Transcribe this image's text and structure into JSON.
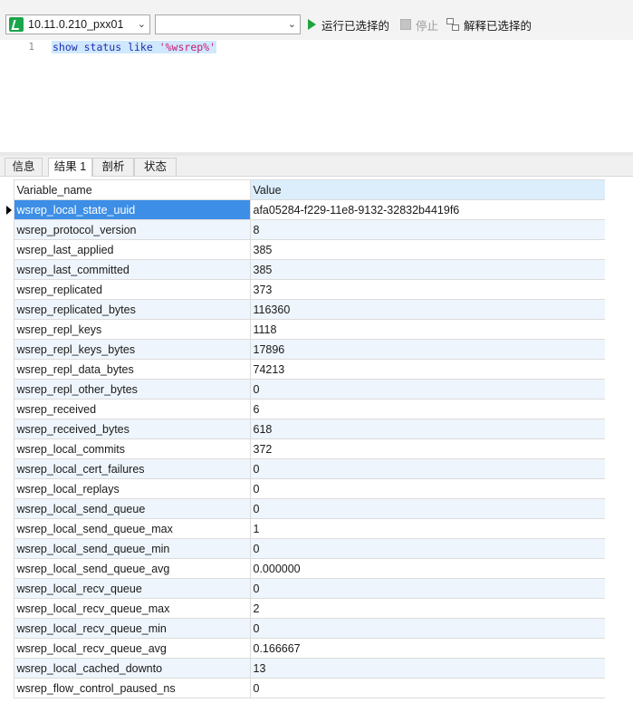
{
  "toolbar": {
    "connection": "10.11.0.210_pxx01",
    "database": "",
    "run_selected": "运行已选择的",
    "stop": "停止",
    "explain_selected": "解释已选择的"
  },
  "editor": {
    "line_number": "1",
    "kw1": "show status like ",
    "str": "'%wsrep%'"
  },
  "tabs": [
    "信息",
    "结果 1",
    "剖析",
    "状态"
  ],
  "grid": {
    "columns": [
      "Variable_name",
      "Value"
    ],
    "rows": [
      [
        "wsrep_local_state_uuid",
        "afa05284-f229-11e8-9132-32832b4419f6"
      ],
      [
        "wsrep_protocol_version",
        "8"
      ],
      [
        "wsrep_last_applied",
        "385"
      ],
      [
        "wsrep_last_committed",
        "385"
      ],
      [
        "wsrep_replicated",
        "373"
      ],
      [
        "wsrep_replicated_bytes",
        "116360"
      ],
      [
        "wsrep_repl_keys",
        "1118"
      ],
      [
        "wsrep_repl_keys_bytes",
        "17896"
      ],
      [
        "wsrep_repl_data_bytes",
        "74213"
      ],
      [
        "wsrep_repl_other_bytes",
        "0"
      ],
      [
        "wsrep_received",
        "6"
      ],
      [
        "wsrep_received_bytes",
        "618"
      ],
      [
        "wsrep_local_commits",
        "372"
      ],
      [
        "wsrep_local_cert_failures",
        "0"
      ],
      [
        "wsrep_local_replays",
        "0"
      ],
      [
        "wsrep_local_send_queue",
        "0"
      ],
      [
        "wsrep_local_send_queue_max",
        "1"
      ],
      [
        "wsrep_local_send_queue_min",
        "0"
      ],
      [
        "wsrep_local_send_queue_avg",
        "0.000000"
      ],
      [
        "wsrep_local_recv_queue",
        "0"
      ],
      [
        "wsrep_local_recv_queue_max",
        "2"
      ],
      [
        "wsrep_local_recv_queue_min",
        "0"
      ],
      [
        "wsrep_local_recv_queue_avg",
        "0.166667"
      ],
      [
        "wsrep_local_cached_downto",
        "13"
      ],
      [
        "wsrep_flow_control_paused_ns",
        "0"
      ]
    ]
  },
  "colors": {
    "selected_row": "#3d8ee6",
    "alt_row": "#eef5fc",
    "run_green": "#1fa33c",
    "keyword_blue": "#1f2fb0",
    "string_magenta": "#c91a78"
  }
}
